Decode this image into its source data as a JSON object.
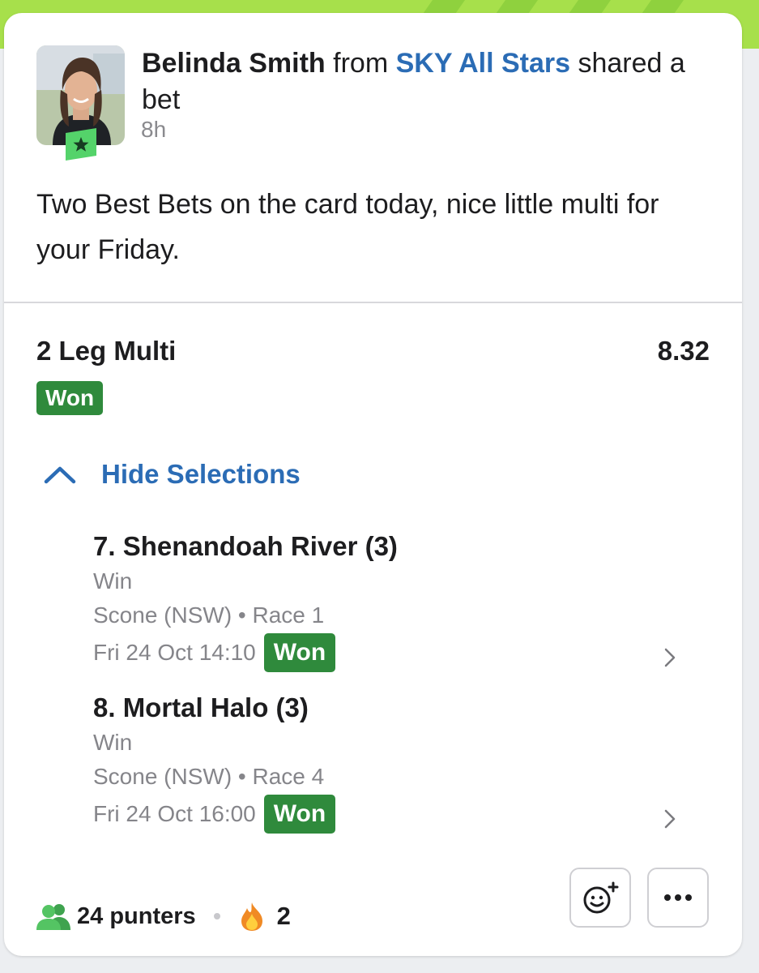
{
  "post": {
    "author_name": "Belinda Smith",
    "from_text": "from",
    "group_name": "SKY All Stars",
    "action_text": "shared a bet",
    "time_ago": "8h",
    "message": "Two Best Bets on the card today, nice little multi for your Friday."
  },
  "bet": {
    "type": "2 Leg Multi",
    "odds": "8.32",
    "status": "Won",
    "toggle_label": "Hide Selections",
    "legs": [
      {
        "runner": "7. Shenandoah River (3)",
        "market": "Win",
        "meeting": "Scone (NSW) • Race 1",
        "datetime": "Fri 24 Oct 14:10",
        "status": "Won"
      },
      {
        "runner": "8. Mortal Halo (3)",
        "market": "Win",
        "meeting": "Scone (NSW) • Race 4",
        "datetime": "Fri 24 Oct 16:00",
        "status": "Won"
      }
    ]
  },
  "footer": {
    "punters": "24 punters",
    "reactions": "2"
  },
  "icons": {
    "people": "people-icon",
    "fire": "fire-icon",
    "react": "add-reaction-icon",
    "more": "more-dots-icon",
    "collapse": "chevron-up-icon",
    "leg_arrow": "chevron-right-icon",
    "avatar_badge": "star-badge-icon"
  },
  "colors": {
    "brand_green": "#a7e04b",
    "link_blue": "#2b6cb5",
    "won_green": "#2f8a3c"
  }
}
